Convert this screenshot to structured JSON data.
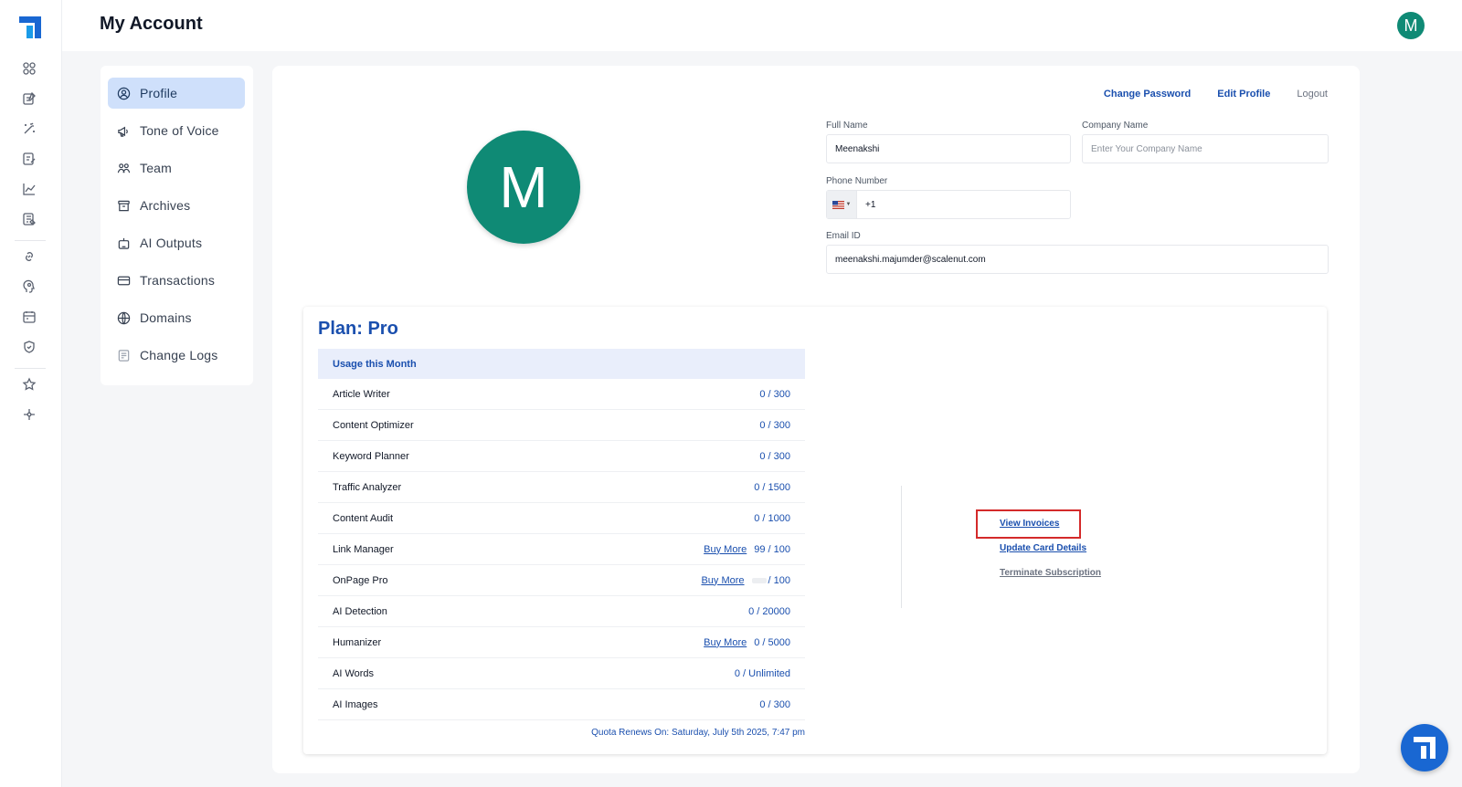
{
  "header": {
    "title": "My Account",
    "avatar_letter": "M"
  },
  "rail": {
    "icons": [
      "dashboard-icon",
      "edit-doc-icon",
      "magic-wand-icon",
      "content-icon",
      "chart-icon",
      "article-icon",
      "link-icon",
      "brain-icon",
      "calendar-icon",
      "shield-icon",
      "star-icon",
      "connector-icon"
    ]
  },
  "subnav": {
    "items": [
      {
        "label": "Profile",
        "icon": "user-circle-icon",
        "active": true
      },
      {
        "label": "Tone of Voice",
        "icon": "megaphone-icon"
      },
      {
        "label": "Team",
        "icon": "team-icon"
      },
      {
        "label": "Archives",
        "icon": "archive-icon"
      },
      {
        "label": "AI Outputs",
        "icon": "robot-icon"
      },
      {
        "label": "Transactions",
        "icon": "card-icon"
      },
      {
        "label": "Domains",
        "icon": "globe-icon"
      },
      {
        "label": "Change Logs",
        "icon": "log-icon"
      }
    ]
  },
  "profile": {
    "links": {
      "change_password": "Change Password",
      "edit_profile": "Edit Profile",
      "logout": "Logout"
    },
    "avatar_letter": "M",
    "full_name": {
      "label": "Full Name",
      "value": "Meenakshi"
    },
    "company_name": {
      "label": "Company Name",
      "placeholder": "Enter Your Company Name"
    },
    "phone": {
      "label": "Phone Number",
      "value": "+1"
    },
    "email": {
      "label": "Email ID",
      "value": "meenakshi.majumder@scalenut.com"
    }
  },
  "plan": {
    "title": "Plan: Pro",
    "usage_header": "Usage this Month",
    "rows": [
      {
        "name": "Article Writer",
        "value": "0 / 300"
      },
      {
        "name": "Content Optimizer",
        "value": "0 / 300"
      },
      {
        "name": "Keyword Planner",
        "value": "0 / 300"
      },
      {
        "name": "Traffic Analyzer",
        "value": "0 / 1500"
      },
      {
        "name": "Content Audit",
        "value": "0 / 1000"
      },
      {
        "name": "Link Manager",
        "buy": "Buy More",
        "value": "99 / 100"
      },
      {
        "name": "OnPage Pro",
        "buy": "Buy More",
        "value": "/ 100",
        "has_bar": true
      },
      {
        "name": "AI Detection",
        "value": "0 / 20000"
      },
      {
        "name": "Humanizer",
        "buy": "Buy More",
        "value": "0 / 5000"
      },
      {
        "name": "AI Words",
        "value": "0 / Unlimited"
      },
      {
        "name": "AI Images",
        "value": "0 / 300"
      }
    ],
    "quota": "Quota Renews On: Saturday, July 5th 2025, 7:47 pm",
    "actions": {
      "view_invoices": "View Invoices",
      "update_card": "Update Card Details",
      "terminate": "Terminate Subscription"
    }
  },
  "colors": {
    "accent": "#1a4fae",
    "avatar": "#0f8a75",
    "highlight": "#d42a2a",
    "fab": "#1967d2"
  }
}
